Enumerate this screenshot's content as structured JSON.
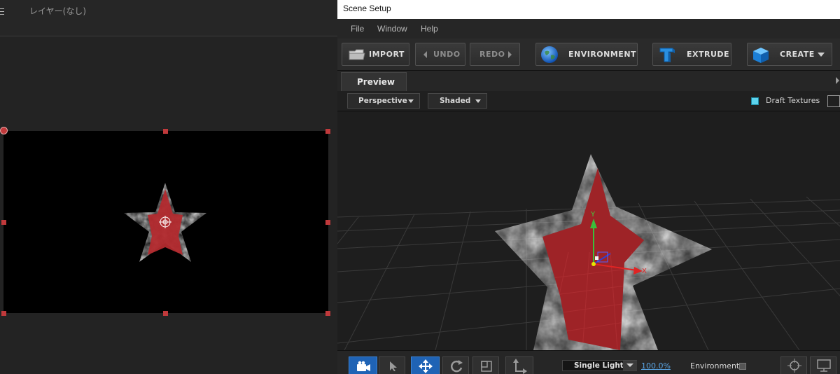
{
  "left_panel": {
    "layer_label": "レイヤー(なし)",
    "colors": {
      "canvas_bg": "#000000",
      "handle": "#c0393b",
      "star_red": "#b32a2e"
    }
  },
  "scene_setup": {
    "window_title": "Scene Setup",
    "menu": [
      "File",
      "Window",
      "Help"
    ],
    "toolbar": {
      "import_label": "IMPORT",
      "undo_label": "UNDO",
      "redo_label": "REDO",
      "environment_label": "ENVIRONMENT",
      "extrude_label": "EXTRUDE",
      "create_label": "CREATE"
    },
    "tab_label": "Preview",
    "view_mode": "Perspective",
    "shading_mode": "Shaded",
    "draft_textures_label": "Draft Textures",
    "draft_textures_checked": true,
    "axis_labels": {
      "y": "Y",
      "x": "X"
    },
    "bottom": {
      "light_mode": "Single Light",
      "zoom": "100.0%",
      "environment_label": "Environment"
    },
    "colors": {
      "accent": "#1f63b5",
      "checkbox": "#5dd4ee",
      "zoom_link": "#5aa6e6"
    }
  }
}
